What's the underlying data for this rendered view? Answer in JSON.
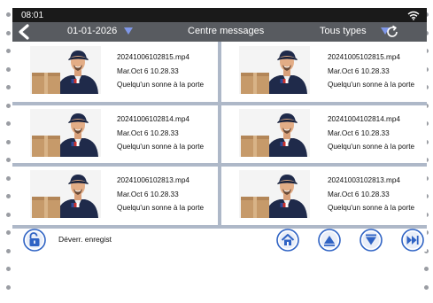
{
  "status_bar": {
    "time": "08:01",
    "wifi_icon": "wifi-icon"
  },
  "header": {
    "back_icon": "back-chevron-icon",
    "date": "01-01-2026",
    "title": "Centre messages",
    "type_filter": "Tous types",
    "refresh_icon": "refresh-icon",
    "accent_color": "#7f97e8"
  },
  "messages": [
    {
      "filename": "20241006102815.mp4",
      "datetime": "Mar.Oct 6 10.28.33",
      "description": "Quelqu'un sonne à la porte"
    },
    {
      "filename": "20241005102815.mp4",
      "datetime": "Mar.Oct 6 10.28.33",
      "description": "Quelqu'un sonne à la porte"
    },
    {
      "filename": "20241006102814.mp4",
      "datetime": "Mar.Oct 6 10.28.33",
      "description": "Quelqu'un sonne à la porte"
    },
    {
      "filename": "20241004102814.mp4",
      "datetime": "Mar.Oct 6 10.28.33",
      "description": "Quelqu'un sonne à la porte"
    },
    {
      "filename": "20241006102813.mp4",
      "datetime": "Mar.Oct 6 10.28.33",
      "description": "Quelqu'un sonne à la porte"
    },
    {
      "filename": "20241003102813.mp4",
      "datetime": "Mar.Oct 6 10.28.33",
      "description": "Quelqu'un sonne à la porte"
    }
  ],
  "footer": {
    "unlock_label": "Déverr. enregist",
    "unlock_icon": "unlock-icon",
    "home_icon": "home-icon",
    "up_icon": "page-up-icon",
    "down_icon": "page-down-icon",
    "forward_icon": "fast-forward-icon",
    "button_color": "#2f63c4"
  }
}
